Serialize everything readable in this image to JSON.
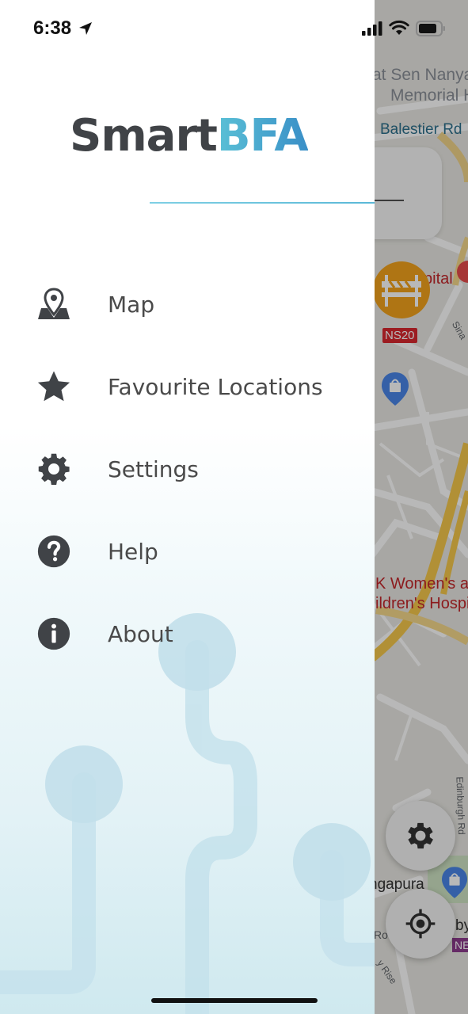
{
  "status_bar": {
    "time": "6:38"
  },
  "drawer": {
    "logo": {
      "part1": "Smart",
      "part2": "BFA"
    },
    "menu": [
      {
        "label": "Map",
        "icon": "map-pin-icon"
      },
      {
        "label": "Favourite Locations",
        "icon": "star-icon"
      },
      {
        "label": "Settings",
        "icon": "gear-icon"
      },
      {
        "label": "Help",
        "icon": "question-circle-icon"
      },
      {
        "label": "About",
        "icon": "info-circle-icon"
      }
    ]
  },
  "map": {
    "labels": {
      "memorial_line1": "at Sen Nanya",
      "memorial_line2": "Memorial H",
      "road_balestier": "Balestier Rd",
      "hospital": "pital",
      "station_code": "NS20",
      "womens1": "K Women's ar",
      "womens2": "ildren's Hospit",
      "edinburgh": "Edinburgh Rd",
      "singapura": "ngapura",
      "ne_code": "NE",
      "by": "by",
      "ro": "Ro",
      "rise": "y Rise",
      "sinaran": "Sina"
    }
  },
  "colors": {
    "accent_blue": "#3fa9c9",
    "text_dark": "#404347",
    "fab_orange": "#f3a21c"
  }
}
